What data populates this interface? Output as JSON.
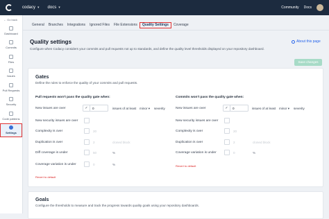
{
  "topbar": {
    "org": "codacy",
    "repo": "docs",
    "links": [
      "Community",
      "Docs"
    ]
  },
  "sidebar": {
    "go_back": "← Go back",
    "items": [
      {
        "label": "Dashboard",
        "icon": "dashboard-icon"
      },
      {
        "label": "Commits",
        "icon": "commits-icon"
      },
      {
        "label": "Files",
        "icon": "files-icon"
      },
      {
        "label": "Issues",
        "icon": "issues-icon"
      },
      {
        "label": "Pull Requests",
        "icon": "pull-requests-icon"
      },
      {
        "label": "Security",
        "icon": "security-icon"
      },
      {
        "label": "Code patterns",
        "icon": "code-patterns-icon"
      },
      {
        "label": "Settings",
        "icon": "settings-icon",
        "active": true
      }
    ]
  },
  "tabs": [
    "General",
    "Branches",
    "Integrations",
    "Ignored Files",
    "File Extensions",
    "Quality Settings",
    "Coverage"
  ],
  "active_tab": "Quality Settings",
  "page": {
    "title": "Quality settings",
    "description": "Configure when Codacy considers your commits and pull requests not up to standards, and define the quality level thresholds displayed on your repository dashboard.",
    "about": "About this page",
    "save_label": "Save changes"
  },
  "gates": {
    "title": "Gates",
    "description": "Define the rules to enforce the quality of your commits and pull requests.",
    "pr": {
      "title": "Pull requests won't pass the quality gate when:",
      "rows": [
        {
          "label": "New issues are over",
          "checked": true,
          "value": "0",
          "suffix": "issues of at least",
          "severity": "minor",
          "after": "severity"
        },
        {
          "label": "New security issues are over",
          "checked": false,
          "value": ""
        },
        {
          "label": "Complexity is over",
          "checked": false,
          "value": "",
          "placeholder": "20"
        },
        {
          "label": "Duplication is over",
          "checked": false,
          "value": "",
          "placeholder": "2",
          "ghost": "cloned block"
        },
        {
          "label": "Diff coverage is under",
          "checked": false,
          "value": "",
          "placeholder": "50",
          "suffix": "%"
        },
        {
          "label": "Coverage variation is under",
          "checked": false,
          "value": "",
          "placeholder": "0",
          "suffix": "%"
        }
      ],
      "reset": "Revert to default"
    },
    "commits": {
      "title": "Commits won't pass the quality gate when:",
      "rows": [
        {
          "label": "New issues are over",
          "checked": true,
          "value": "0",
          "suffix": "issues of at least",
          "severity": "minor",
          "after": "severity"
        },
        {
          "label": "New security issues are over",
          "checked": false,
          "value": ""
        },
        {
          "label": "Complexity is over",
          "checked": false,
          "value": "",
          "placeholder": "20"
        },
        {
          "label": "Duplication is over",
          "checked": false,
          "value": "",
          "placeholder": "2",
          "ghost": "cloned block"
        },
        {
          "label": "Coverage variation is under",
          "checked": false,
          "value": "",
          "placeholder": "0",
          "suffix": "%"
        }
      ],
      "reset": "Revert to default"
    }
  },
  "goals": {
    "title": "Goals",
    "description": "Configure the thresholds to measure and track the progress towards quality goals using your repository dashboards."
  },
  "colors": {
    "topbar": "#1c2b3f",
    "highlight": "#e03131",
    "link": "#2563eb",
    "save_disabled": "#a7dbc7"
  }
}
